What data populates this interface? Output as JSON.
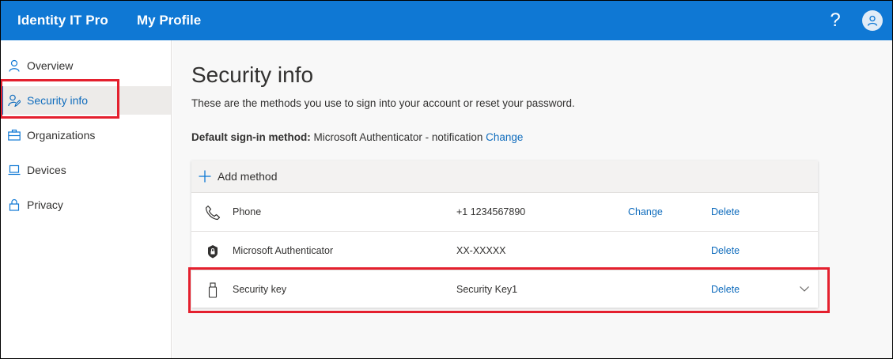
{
  "header": {
    "brand": "Identity IT Pro",
    "app_title": "My Profile",
    "help_glyph": "?",
    "accent_color": "#0f78d4"
  },
  "sidebar": {
    "items": [
      {
        "label": "Overview",
        "icon": "person-icon"
      },
      {
        "label": "Security info",
        "icon": "person-edit-icon",
        "active": true
      },
      {
        "label": "Organizations",
        "icon": "briefcase-icon"
      },
      {
        "label": "Devices",
        "icon": "laptop-icon"
      },
      {
        "label": "Privacy",
        "icon": "lock-icon"
      }
    ]
  },
  "main": {
    "title": "Security info",
    "description": "These are the methods you use to sign into your account or reset your password.",
    "default_method": {
      "label": "Default sign-in method:",
      "value": "Microsoft Authenticator - notification",
      "change_link": "Change"
    },
    "add_method_label": "Add method",
    "methods": [
      {
        "name": "Phone",
        "value": "+1 1234567890",
        "change": "Change",
        "delete": "Delete",
        "icon": "phone-icon"
      },
      {
        "name": "Microsoft Authenticator",
        "value": "XX-XXXXX",
        "change": "",
        "delete": "Delete",
        "icon": "lock-badge-icon"
      },
      {
        "name": "Security key",
        "value": "Security Key1",
        "change": "",
        "delete": "Delete",
        "icon": "usb-key-icon"
      }
    ]
  },
  "highlight_color": "#e4202e"
}
